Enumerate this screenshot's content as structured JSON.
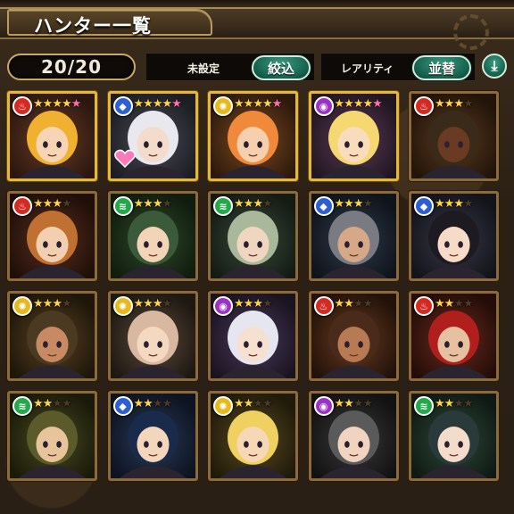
{
  "header": {
    "title": "ハンター一覧"
  },
  "toolbar": {
    "count": "20/20",
    "filter_status": "未設定",
    "filter_button": "絞込",
    "sort_label": "レアリティ",
    "sort_button": "並替",
    "sort_order_icon": "arrow-down-icon"
  },
  "colors": {
    "fire": "#d42a22",
    "water": "#2c5fd0",
    "wind": "#23a84a",
    "light": "#e6b91c",
    "dark": "#9b32c6",
    "frame_gold": "#e5b73a",
    "frame_bronze": "#8c6a3c",
    "button_green": "#14614e"
  },
  "hunters": [
    {
      "attr": "fire",
      "attr_icon": "fire-icon",
      "stars": 4,
      "plus": true,
      "frame": "gold",
      "favorite": false
    },
    {
      "attr": "water",
      "attr_icon": "water-icon",
      "stars": 4,
      "plus": true,
      "frame": "gold",
      "favorite": true
    },
    {
      "attr": "light",
      "attr_icon": "light-icon",
      "stars": 4,
      "plus": true,
      "frame": "gold",
      "favorite": false
    },
    {
      "attr": "dark",
      "attr_icon": "dark-icon",
      "stars": 4,
      "plus": true,
      "frame": "gold",
      "favorite": false
    },
    {
      "attr": "fire",
      "attr_icon": "fire-icon",
      "stars": 3,
      "plus": false,
      "frame": "bronze",
      "favorite": false
    },
    {
      "attr": "fire",
      "attr_icon": "fire-icon",
      "stars": 3,
      "plus": false,
      "frame": "bronze",
      "favorite": false
    },
    {
      "attr": "wind",
      "attr_icon": "wind-icon",
      "stars": 3,
      "plus": false,
      "frame": "bronze",
      "favorite": false
    },
    {
      "attr": "wind",
      "attr_icon": "wind-icon",
      "stars": 3,
      "plus": false,
      "frame": "bronze",
      "favorite": false
    },
    {
      "attr": "water",
      "attr_icon": "water-icon",
      "stars": 3,
      "plus": false,
      "frame": "bronze",
      "favorite": false
    },
    {
      "attr": "water",
      "attr_icon": "water-icon",
      "stars": 3,
      "plus": false,
      "frame": "bronze",
      "favorite": false
    },
    {
      "attr": "light",
      "attr_icon": "light-icon",
      "stars": 3,
      "plus": false,
      "frame": "bronze",
      "favorite": false
    },
    {
      "attr": "light",
      "attr_icon": "light-icon",
      "stars": 3,
      "plus": false,
      "frame": "bronze",
      "favorite": false
    },
    {
      "attr": "dark",
      "attr_icon": "dark-icon",
      "stars": 3,
      "plus": false,
      "frame": "bronze",
      "favorite": false
    },
    {
      "attr": "fire",
      "attr_icon": "fire-icon",
      "stars": 2,
      "plus": false,
      "frame": "bronze",
      "favorite": false
    },
    {
      "attr": "fire",
      "attr_icon": "fire-icon",
      "stars": 2,
      "plus": false,
      "frame": "bronze",
      "favorite": false
    },
    {
      "attr": "wind",
      "attr_icon": "wind-icon",
      "stars": 2,
      "plus": false,
      "frame": "bronze",
      "favorite": false
    },
    {
      "attr": "water",
      "attr_icon": "water-icon",
      "stars": 2,
      "plus": false,
      "frame": "bronze",
      "favorite": false
    },
    {
      "attr": "light",
      "attr_icon": "light-icon",
      "stars": 2,
      "plus": false,
      "frame": "bronze",
      "favorite": false
    },
    {
      "attr": "dark",
      "attr_icon": "dark-icon",
      "stars": 2,
      "plus": false,
      "frame": "bronze",
      "favorite": false
    },
    {
      "attr": "wind",
      "attr_icon": "wind-icon",
      "stars": 2,
      "plus": false,
      "frame": "bronze",
      "favorite": false
    }
  ]
}
